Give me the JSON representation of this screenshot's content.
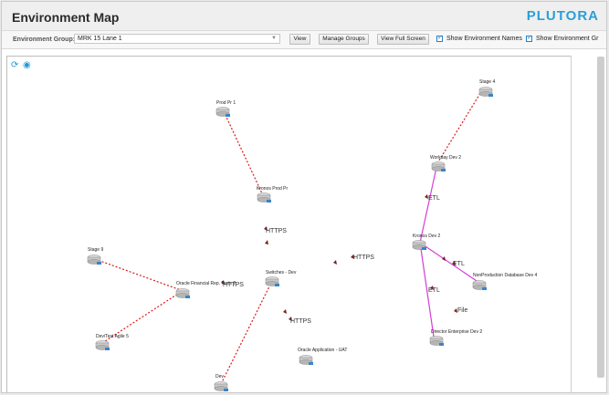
{
  "header": {
    "title": "Environment Map",
    "brand": "PLUTORA"
  },
  "toolbar": {
    "group_label": "Environment Group:",
    "group_value": "MRK 15 Lane 1",
    "view_label": "View",
    "manage_groups_label": "Manage Groups",
    "full_screen_label": "View Full Screen",
    "show_names_label": "Show Environment Names",
    "show_groups_label": "Show Environment Gr"
  },
  "map_controls": {
    "icons": [
      "rotate-icon",
      "eye-icon"
    ]
  },
  "colors": {
    "dotted_link": "#d61c1c",
    "integration_link": "#d43fd6",
    "arrow": "#7a2020",
    "brand": "#2a9fd6"
  },
  "nodes": [
    {
      "id": "stage4",
      "label": "Stage 4"
    },
    {
      "id": "prodpr1",
      "label": "Prod Pr 1"
    },
    {
      "id": "workday",
      "label": "Workday Dev 2"
    },
    {
      "id": "kronosprod",
      "label": "Kronos Prod Pr"
    },
    {
      "id": "kronosdev",
      "label": "Kronos Dev 2"
    },
    {
      "id": "stage9",
      "label": "Stage 9"
    },
    {
      "id": "nonprod",
      "label": "NonProduction Database Dev 4"
    },
    {
      "id": "oracle",
      "label": "Oracle Financial Rep. Tests 2"
    },
    {
      "id": "switches",
      "label": "Switches - Dev"
    },
    {
      "id": "director",
      "label": "Director Enterprise Dev 2"
    },
    {
      "id": "devtest",
      "label": "Dev/Test Agile 5"
    },
    {
      "id": "oracleapp",
      "label": "Oracle Application - UAT"
    },
    {
      "id": "dev",
      "label": "Dev"
    }
  ],
  "edge_labels": [
    "HTTPS",
    "HTTPS",
    "HTTPS",
    "HTTPS",
    "ETL",
    "ETL",
    "ETL",
    "File"
  ]
}
